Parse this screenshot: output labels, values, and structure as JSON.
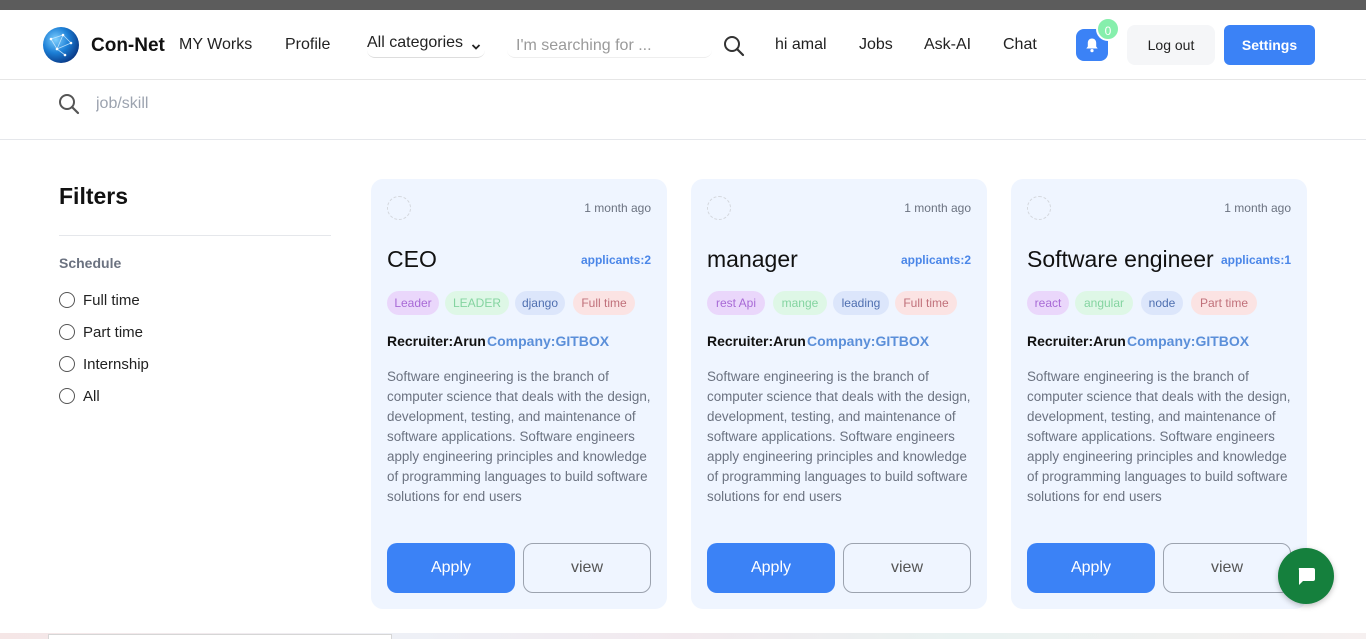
{
  "navbar": {
    "brand": "Con-Net",
    "links": {
      "my_works": "MY Works",
      "profile": "Profile",
      "greeting": "hi amal",
      "jobs": "Jobs",
      "ask_ai": "Ask-AI",
      "chat": "Chat"
    },
    "category_select": "All categories",
    "search_placeholder": "I'm searching for ...",
    "notification_count": "0",
    "logout_label": "Log out",
    "settings_label": "Settings"
  },
  "job_search": {
    "placeholder": "job/skill"
  },
  "filters": {
    "title": "Filters",
    "schedule_label": "Schedule",
    "options": [
      "Full time",
      "Part time",
      "Internship",
      "All"
    ]
  },
  "cards": [
    {
      "time": "1 month ago",
      "title": "CEO",
      "applicants": "applicants:2",
      "tags": [
        "Leader",
        "LEADER",
        "django",
        "Full time"
      ],
      "recruiter": "Recruiter:Arun",
      "company": "Company:GITBOX",
      "description": "Software engineering is the branch of computer science that deals with the design, development, testing, and maintenance of software applications. Software engineers apply engineering principles and knowledge of programming languages to build software solutions for end users",
      "apply": "Apply",
      "view": "view"
    },
    {
      "time": "1 month ago",
      "title": "manager",
      "applicants": "applicants:2",
      "tags": [
        "rest Api",
        "mange",
        "leading",
        "Full time"
      ],
      "recruiter": "Recruiter:Arun",
      "company": "Company:GITBOX",
      "description": "Software engineering is the branch of computer science that deals with the design, development, testing, and maintenance of software applications. Software engineers apply engineering principles and knowledge of programming languages to build software solutions for end users",
      "apply": "Apply",
      "view": "view"
    },
    {
      "time": "1 month ago",
      "title": "Software engineer",
      "applicants": "applicants:1",
      "tags": [
        "react",
        "angular",
        "node",
        "Part time"
      ],
      "recruiter": "Recruiter:Arun",
      "company": "Company:GITBOX",
      "description": "Software engineering is the branch of computer science that deals with the design, development, testing, and maintenance of software applications. Software engineers apply engineering principles and knowledge of programming languages to build software solutions for end users",
      "apply": "Apply",
      "view": "view"
    }
  ],
  "colors": {
    "accent": "#3b82f6",
    "card_bg": "#eff5ff",
    "tag_purple": "#e9d5ff",
    "tag_green": "#dcfce7",
    "tag_blue": "#dbeafe",
    "tag_red": "#fee2e2",
    "chat_fab": "#15803d"
  }
}
